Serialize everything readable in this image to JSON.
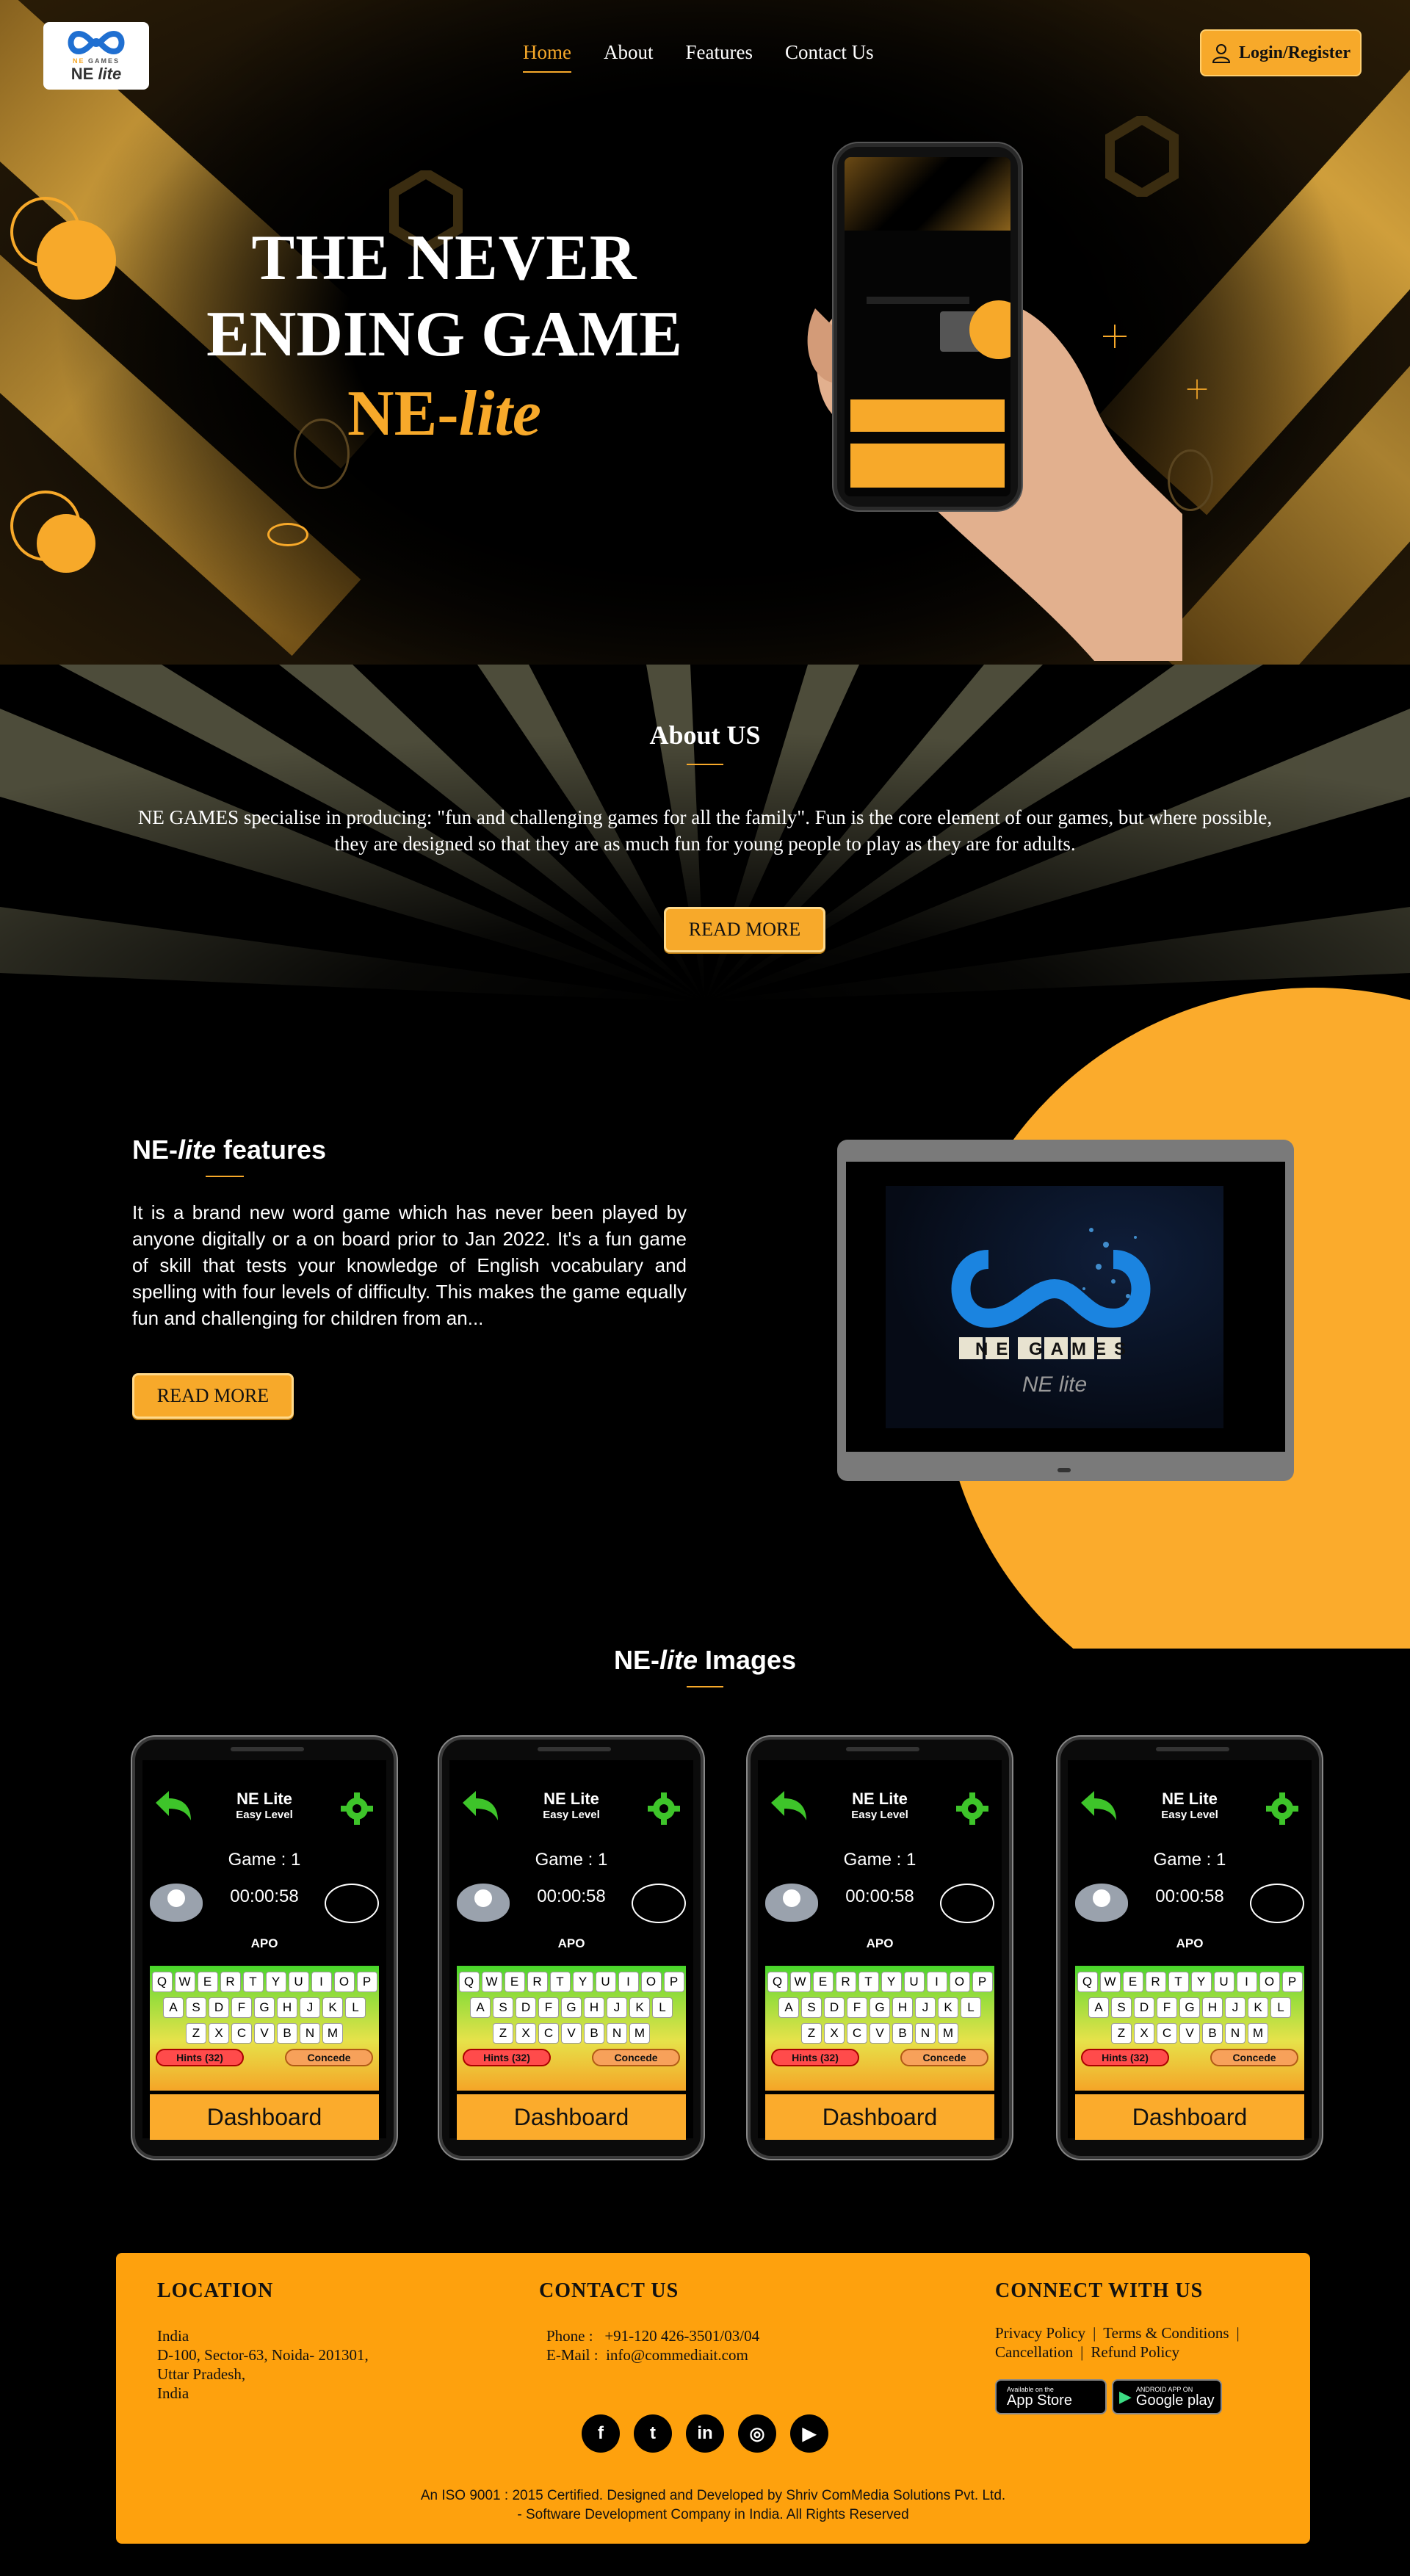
{
  "header": {
    "logo_brand_ne": "NE",
    "logo_brand_games": "GAMES",
    "logo_sub_ne": "NE",
    "logo_sub_lite": "lite",
    "nav": [
      {
        "label": "Home",
        "active": true
      },
      {
        "label": "About",
        "active": false
      },
      {
        "label": "Features",
        "active": false
      },
      {
        "label": "Contact Us",
        "active": false
      }
    ],
    "login_label": "Login/Register"
  },
  "hero": {
    "line1": "THE NEVER",
    "line2": "ENDING GAME",
    "line3_ne": "NE-",
    "line3_lite": "lite",
    "accent_color": "#f7a92a"
  },
  "about": {
    "heading": "About US",
    "text": "NE GAMES specialise in producing: \"fun and challenging games for all the family\". Fun is the core element of our games, but where possible, they are designed so that they are as much fun for young people to play as they are for adults.",
    "button": "READ MORE"
  },
  "features": {
    "heading_ne": "NE-",
    "heading_lite": "lite",
    "heading_rest": " features",
    "text": "It is a brand new word game which has never been played by anyone digitally or a on board prior to Jan 2022. It's a fun game of skill that tests your knowledge of English vocabulary and spelling with four levels of difficulty. This makes the game equally fun and challenging for children from an...",
    "button": "READ MORE",
    "laptop_brand": "NE GAMES",
    "laptop_sub": "NE lite"
  },
  "images": {
    "heading_ne": "NE-",
    "heading_lite": "lite",
    "heading_rest": " Images",
    "phones": [
      {
        "title": "NE Lite",
        "level": "Easy Level",
        "game": "Game : 1",
        "time": "00:00:58",
        "word": "APO",
        "hints": "Hints (32)",
        "concede": "Concede",
        "dashboard": "Dashboard"
      },
      {
        "title": "NE Lite",
        "level": "Easy Level",
        "game": "Game : 1",
        "time": "00:00:58",
        "word": "APO",
        "hints": "Hints (32)",
        "concede": "Concede",
        "dashboard": "Dashboard"
      },
      {
        "title": "NE Lite",
        "level": "Easy Level",
        "game": "Game : 1",
        "time": "00:00:58",
        "word": "APO",
        "hints": "Hints (32)",
        "concede": "Concede",
        "dashboard": "Dashboard"
      },
      {
        "title": "NE Lite",
        "level": "Easy Level",
        "game": "Game : 1",
        "time": "00:00:58",
        "word": "APO",
        "hints": "Hints (32)",
        "concede": "Concede",
        "dashboard": "Dashboard"
      }
    ],
    "keyboard_rows": [
      [
        "Q",
        "W",
        "E",
        "R",
        "T",
        "Y",
        "U",
        "I",
        "O",
        "P"
      ],
      [
        "A",
        "S",
        "D",
        "F",
        "G",
        "H",
        "J",
        "K",
        "L"
      ],
      [
        "Z",
        "X",
        "C",
        "V",
        "B",
        "N",
        "M"
      ]
    ]
  },
  "footer": {
    "location_heading": "LOCATION",
    "location_lines": [
      "India",
      "D-100, Sector-63, Noida- 201301,",
      "Uttar Pradesh,",
      "India"
    ],
    "contact_heading": "CONTACT US",
    "phone_label": "Phone :",
    "phone_value": "+91-120 426-3501/03/04",
    "email_label": "E-Mail :",
    "email_value": "info@commediait.com",
    "connect_heading": "CONNECT WITH US",
    "links": [
      "Privacy Policy",
      "Terms & Conditions",
      "Cancellation",
      "Refund Policy"
    ],
    "appstore_small": "Available on the",
    "appstore_big": "App Store",
    "googleplay_small": "ANDROID APP ON",
    "googleplay_big": "Google play",
    "socials": [
      {
        "icon": "facebook-icon",
        "glyph": "f"
      },
      {
        "icon": "twitter-icon",
        "glyph": "t"
      },
      {
        "icon": "linkedin-icon",
        "glyph": "in"
      },
      {
        "icon": "instagram-icon",
        "glyph": "◎"
      },
      {
        "icon": "youtube-icon",
        "glyph": "▶"
      }
    ],
    "copyright_line1": "An ISO 9001 : 2015 Certified. Designed and Developed by Shriv ComMedia Solutions Pvt. Ltd.",
    "copyright_line2": "- Software Development Company in India. All Rights Reserved",
    "bg_color": "#fea10d"
  }
}
